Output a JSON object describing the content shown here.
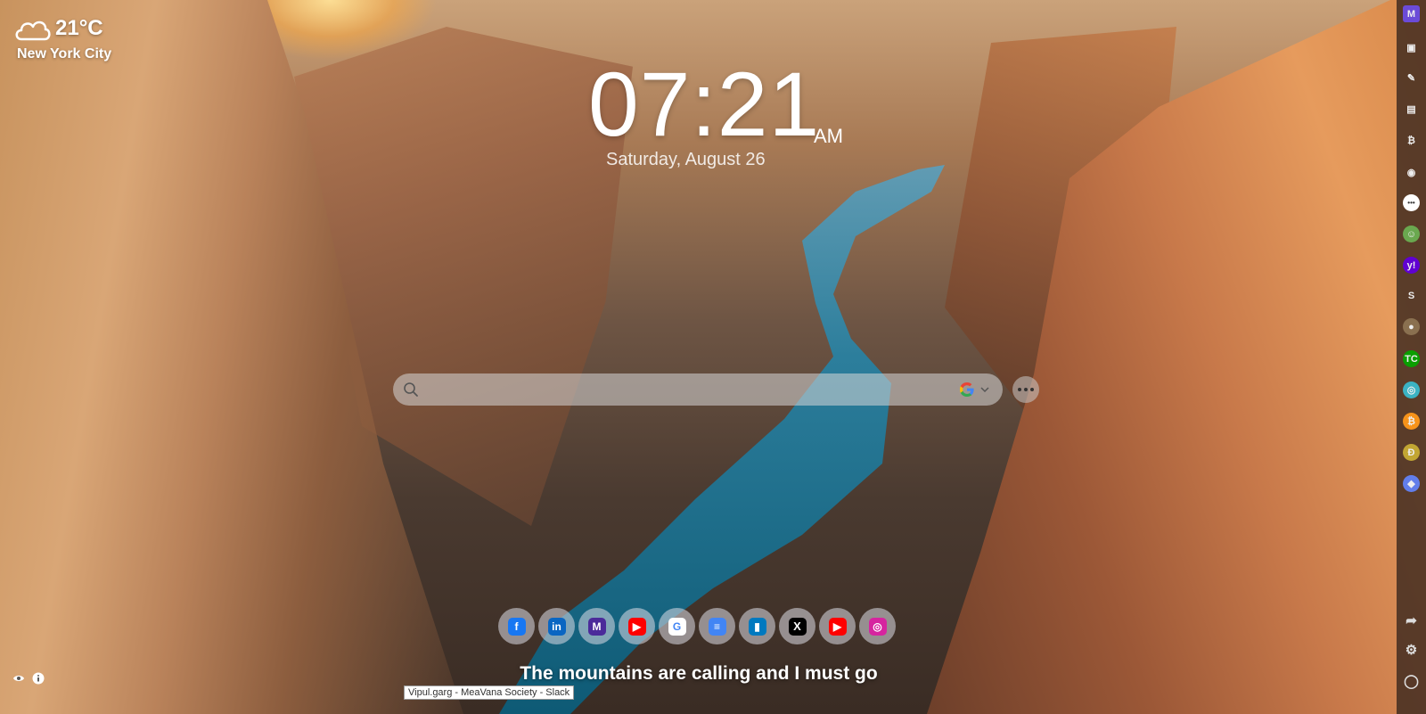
{
  "weather": {
    "temperature": "21°C",
    "city": "New York City",
    "icon": "cloud-icon"
  },
  "clock": {
    "time": "07:21",
    "period": "AM",
    "date": "Saturday, August 26"
  },
  "search": {
    "placeholder": "",
    "value": "",
    "engine": "Google"
  },
  "quick_links": [
    {
      "name": "facebook",
      "icon": "facebook-icon",
      "color": "#1877f2",
      "glyph": "f"
    },
    {
      "name": "linkedin",
      "icon": "linkedin-icon",
      "color": "#0a66c2",
      "glyph": "in"
    },
    {
      "name": "meavana",
      "icon": "meavana-icon",
      "color": "#4b2a9a",
      "glyph": "M"
    },
    {
      "name": "youtube",
      "icon": "youtube-icon",
      "color": "#ff0000",
      "glyph": "▶"
    },
    {
      "name": "google",
      "icon": "google-icon",
      "color": "#4285f4",
      "glyph": "G"
    },
    {
      "name": "google-docs",
      "icon": "docs-icon",
      "color": "#4285f4",
      "glyph": "≡"
    },
    {
      "name": "trello",
      "icon": "trello-icon",
      "color": "#0079bf",
      "glyph": "▮"
    },
    {
      "name": "x",
      "icon": "x-icon",
      "color": "#000000",
      "glyph": "X"
    },
    {
      "name": "youtube",
      "icon": "youtube-icon",
      "color": "#ff0000",
      "glyph": "▶"
    },
    {
      "name": "instagram",
      "icon": "instagram-icon",
      "color": "#d6249f",
      "glyph": "◎"
    }
  ],
  "quote": "The mountains are calling and I must go",
  "tooltip": "Vipul.garg - MeaVana Society - Slack",
  "sidebar": {
    "items": [
      {
        "name": "meavana-logo",
        "glyph": "M",
        "color": "#6b4bd8"
      },
      {
        "name": "background-icon",
        "glyph": "▣",
        "color": "transparent"
      },
      {
        "name": "notes-icon",
        "glyph": "✎",
        "color": "transparent"
      },
      {
        "name": "news-icon",
        "glyph": "▤",
        "color": "transparent"
      },
      {
        "name": "bitcoin-icon",
        "glyph": "₿",
        "color": "transparent"
      },
      {
        "name": "gamepad-icon",
        "glyph": "◉",
        "color": "transparent"
      },
      {
        "name": "messages-icon",
        "glyph": "•••",
        "color": "#ffffff"
      },
      {
        "name": "profile-app-icon",
        "glyph": "☺",
        "color": "#6aa84f"
      },
      {
        "name": "yahoo-icon",
        "glyph": "y!",
        "color": "#6001d2"
      },
      {
        "name": "s-app-icon",
        "glyph": "S",
        "color": "transparent"
      },
      {
        "name": "avatar-app-icon",
        "glyph": "●",
        "color": "#8a7050"
      },
      {
        "name": "techcrunch-icon",
        "glyph": "TC",
        "color": "#0a9e01"
      },
      {
        "name": "crypto-icon",
        "glyph": "◎",
        "color": "#3bb3c3"
      },
      {
        "name": "bitcoin-coin-icon",
        "glyph": "₿",
        "color": "#f7931a"
      },
      {
        "name": "dogecoin-icon",
        "glyph": "Ð",
        "color": "#c2a633"
      },
      {
        "name": "ethereum-icon",
        "glyph": "◆",
        "color": "#627eea"
      }
    ],
    "bottom": [
      {
        "name": "share-icon",
        "glyph": "➦"
      },
      {
        "name": "settings-icon",
        "glyph": "⚙"
      },
      {
        "name": "account-icon",
        "glyph": "◯"
      }
    ]
  }
}
